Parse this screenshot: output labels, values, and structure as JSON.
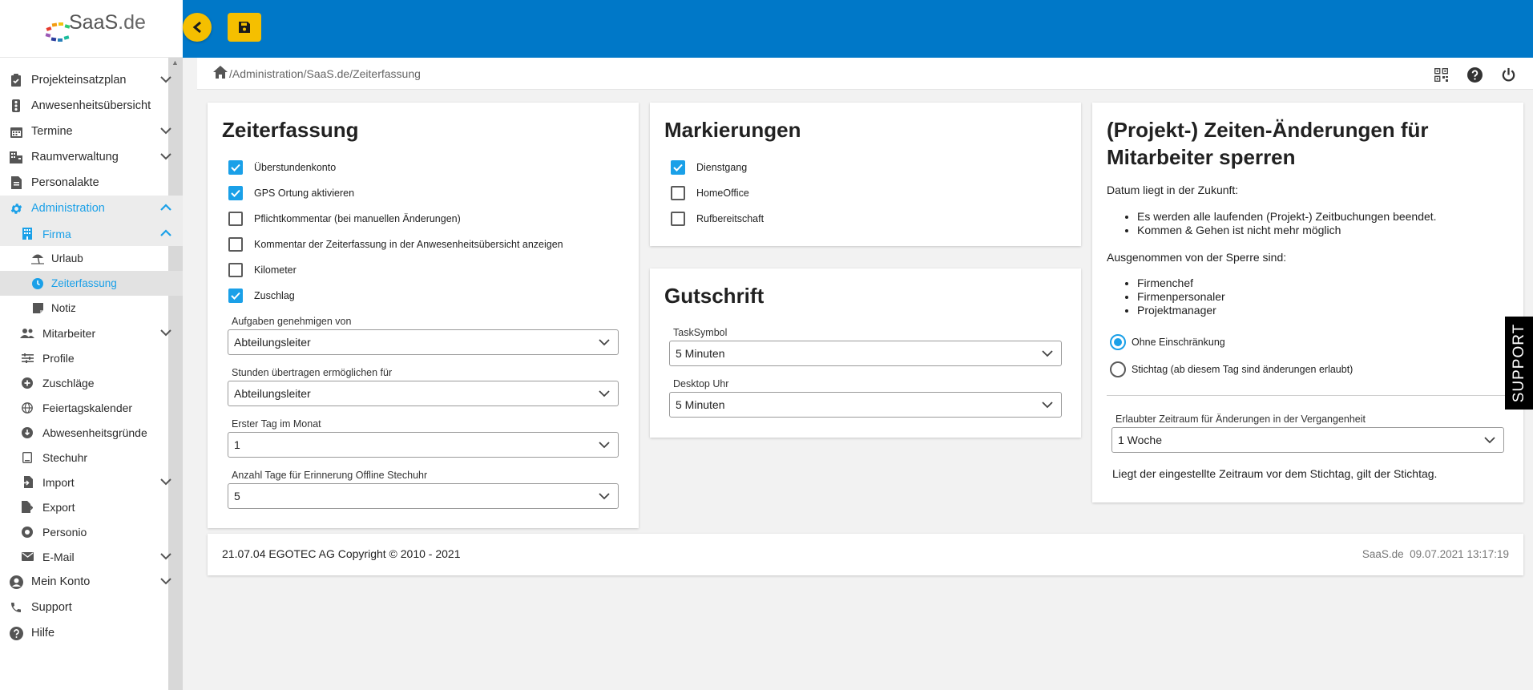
{
  "brand": {
    "logo_text": "SaaS",
    "logo_tld": ".de"
  },
  "sidebar": {
    "items": [
      {
        "label": "Projekteinsatzplan",
        "icon": "clipboard-check-icon"
      },
      {
        "label": "Anwesenheitsübersicht",
        "icon": "traffic-light-icon"
      },
      {
        "label": "Termine",
        "icon": "calendar-icon"
      },
      {
        "label": "Raumverwaltung",
        "icon": "building-icon"
      },
      {
        "label": "Personalakte",
        "icon": "file-icon"
      },
      {
        "label": "Administration",
        "icon": "gear-icon"
      },
      {
        "label": "Firma",
        "icon": "building-small-icon"
      },
      {
        "label": "Urlaub",
        "icon": "beach-umbrella-icon"
      },
      {
        "label": "Zeiterfassung",
        "icon": "clock-icon"
      },
      {
        "label": "Notiz",
        "icon": "note-icon"
      },
      {
        "label": "Mitarbeiter",
        "icon": "users-icon"
      },
      {
        "label": "Profile",
        "icon": "sliders-icon"
      },
      {
        "label": "Zuschläge",
        "icon": "plus-circle-icon"
      },
      {
        "label": "Feiertagskalender",
        "icon": "globe-icon"
      },
      {
        "label": "Abwesenheitsgründe",
        "icon": "download-circle-icon"
      },
      {
        "label": "Stechuhr",
        "icon": "tablet-icon"
      },
      {
        "label": "Import",
        "icon": "file-import-icon"
      },
      {
        "label": "Export",
        "icon": "file-export-icon"
      },
      {
        "label": "Personio",
        "icon": "personio-icon"
      },
      {
        "label": "E-Mail",
        "icon": "envelope-icon"
      },
      {
        "label": "Mein Konto",
        "icon": "user-circle-icon"
      },
      {
        "label": "Support",
        "icon": "phone-icon"
      },
      {
        "label": "Hilfe",
        "icon": "question-circle-icon"
      }
    ]
  },
  "breadcrumb": {
    "path": "/Administration/SaaS.de/Zeiterfassung"
  },
  "toolbar": {
    "toggle_icon": "chevron-left-icon",
    "save_icon": "floppy-disk-icon"
  },
  "header_tools": [
    "qr-code-icon",
    "help-icon",
    "power-icon"
  ],
  "zeiterfassung": {
    "title": "Zeiterfassung",
    "checkboxes": [
      {
        "label": "Überstundenkonto",
        "checked": true
      },
      {
        "label": "GPS Ortung aktivieren",
        "checked": true
      },
      {
        "label": "Pflichtkommentar (bei manuellen Änderungen)",
        "checked": false
      },
      {
        "label": "Kommentar der Zeiterfassung in der Anwesenheitsübersicht anzeigen",
        "checked": false
      },
      {
        "label": "Kilometer",
        "checked": false
      },
      {
        "label": "Zuschlag",
        "checked": true
      }
    ],
    "fields": [
      {
        "label": "Aufgaben genehmigen von",
        "value": "Abteilungsleiter"
      },
      {
        "label": "Stunden übertragen ermöglichen für",
        "value": "Abteilungsleiter"
      },
      {
        "label": "Erster Tag im Monat",
        "value": "1"
      },
      {
        "label": "Anzahl Tage für Erinnerung Offline Stechuhr",
        "value": "5"
      }
    ]
  },
  "markierungen": {
    "title": "Markierungen",
    "checkboxes": [
      {
        "label": "Dienstgang",
        "checked": true
      },
      {
        "label": "HomeOffice",
        "checked": false
      },
      {
        "label": "Rufbereitschaft",
        "checked": false
      }
    ]
  },
  "gutschrift": {
    "title": "Gutschrift",
    "fields": [
      {
        "label": "TaskSymbol",
        "value": "5 Minuten"
      },
      {
        "label": "Desktop Uhr",
        "value": "5 Minuten"
      }
    ]
  },
  "sperre": {
    "title_line1": "(Projekt-) Zeiten-Änderungen für",
    "title_line2": "Mitarbeiter sperren",
    "future_label": "Datum liegt in der Zukunft:",
    "future_items": [
      "Es werden alle laufenden (Projekt-) Zeitbuchungen beendet.",
      "Kommen & Gehen ist nicht mehr möglich"
    ],
    "exempt_label": "Ausgenommen von der Sperre sind:",
    "exempt_items": [
      "Firmenchef",
      "Firmenpersonaler",
      "Projektmanager"
    ],
    "radios": [
      {
        "label": "Ohne Einschränkung",
        "selected": true
      },
      {
        "label": "Stichtag (ab diesem Tag sind änderungen erlaubt)",
        "selected": false
      }
    ],
    "period_field": {
      "label": "Erlaubter Zeitraum für Änderungen in der Vergangenheit",
      "value": "1 Woche"
    },
    "note": "Liegt der eingestellte Zeitraum vor dem Stichtag, gilt der Stichtag."
  },
  "footer": {
    "left": "21.07.04 EGOTEC AG Copyright © 2010 - 2021",
    "right": "SaaS.de  09.07.2021 13:17:19"
  },
  "support_tab": "SUPPORT",
  "colors": {
    "topbar": "#0078c8",
    "accent": "#1aa0e8",
    "button": "#f5bf00"
  }
}
